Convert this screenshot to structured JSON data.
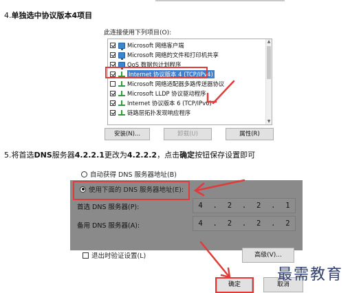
{
  "step4": {
    "prefix": "4.",
    "text": "单独选中协议版本4项目"
  },
  "panel1": {
    "label": "此连接使用下列项目(O):",
    "items": [
      {
        "label": "Microsoft 网络客户端",
        "checked": true,
        "icon": "network-client-icon"
      },
      {
        "label": "Microsoft 网络的文件和打印机共享",
        "checked": true,
        "icon": "file-printer-sharing-icon"
      },
      {
        "label": "QoS 数据包计划程序",
        "checked": true,
        "icon": "qos-icon"
      },
      {
        "label": "Internet 协议版本 4 (TCP/IPv4)",
        "checked": true,
        "icon": "protocol-icon",
        "selected": true
      },
      {
        "label": "Microsoft 网络适配器多路传送器协议",
        "checked": false,
        "icon": "protocol-icon"
      },
      {
        "label": "Microsoft LLDP 协议驱动程序",
        "checked": true,
        "icon": "protocol-icon"
      },
      {
        "label": "Internet 协议版本 6 (TCP/IPv6)",
        "checked": true,
        "icon": "protocol-icon"
      },
      {
        "label": "链路层拓扑发现响应程序",
        "checked": true,
        "icon": "protocol-icon"
      }
    ],
    "buttons": {
      "install": "安装(N)...",
      "uninstall": "卸载(U)",
      "properties": "属性(R)"
    }
  },
  "step5": {
    "prefix": "5.将首选",
    "b1": "DNS",
    "mid1": "服务器",
    "b2": "4.2.2.1",
    "mid2": "更改为",
    "b3": "4.2.2.2",
    "mid3": "，点击",
    "b4": "确定",
    "suffix": "按钮保存设置即可"
  },
  "dns": {
    "auto_label": "自动获得 DNS 服务器地址(B)",
    "manual_label": "使用下面的 DNS 服务器地址(E):",
    "preferred_label": "首选 DNS 服务器(P):",
    "preferred_octets": [
      "4",
      "2",
      "2",
      "1"
    ],
    "alternate_label": "备用 DNS 服务器(A):",
    "alternate_octets": [
      "4",
      "2",
      "2",
      "2"
    ],
    "validate_label": "退出时验证设置(L)",
    "advanced_button": "高级(V)...",
    "ok_button": "确定",
    "cancel_button": "取消"
  },
  "watermark": "最需教育",
  "colors": {
    "highlight_red": "#e13a3a",
    "selection_blue": "#3e7fd0",
    "dim_grey": "#8a8a8a"
  }
}
